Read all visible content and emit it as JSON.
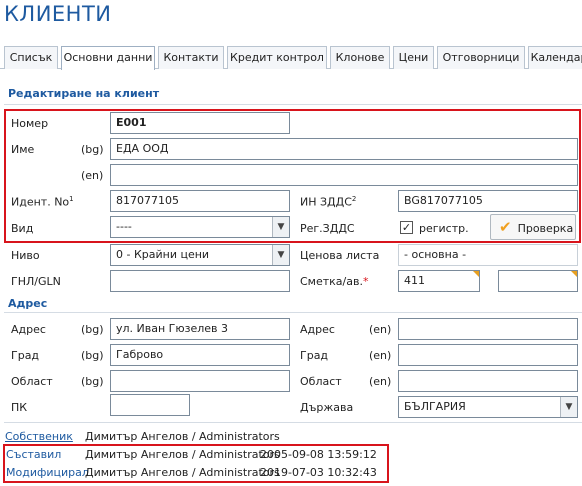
{
  "page_title": "КЛИЕНТИ",
  "tabs": [
    "Списък",
    "Основни данни",
    "Контакти",
    "Кредит контрол",
    "Клонове",
    "Цени",
    "Отговорници",
    "Календар"
  ],
  "active_tab": "Основни данни",
  "form": {
    "section_title": "Редактиране на клиент",
    "number_label": "Номер",
    "number_value": "E001",
    "name_label": "Име",
    "lang_bg": "(bg)",
    "lang_en": "(en)",
    "name_bg_value": "ЕДА ООД",
    "name_en_value": "",
    "ident_label": "Идент. No",
    "ident_sup": "1",
    "ident_value": "817077105",
    "vat_label": "ИН ЗДДС",
    "vat_sup": "2",
    "vat_value": "BG817077105",
    "type_label": "Вид",
    "type_value": "----",
    "reg_vat_label": "Рег.ЗДДС",
    "registered_checked": true,
    "registered_label": "регистр.",
    "check_button_label": "Проверка",
    "level_label": "Ниво",
    "level_value": "0 - Крайни цени",
    "price_list_label": "Ценова листа",
    "price_list_value": "- основна -",
    "gln_label": "ГНЛ/GLN",
    "gln_value": "",
    "account_label": "Сметка/ав.",
    "account_asterisk": "*",
    "account_value": "411",
    "account_extra_value": ""
  },
  "address": {
    "section_title": "Адрес",
    "address_label": "Адрес",
    "address_bg_value": "ул. Иван Гюзелев 3",
    "address_en_value": "",
    "city_label": "Град",
    "city_bg_value": "Габрово",
    "city_en_value": "",
    "region_label": "Област",
    "region_bg_value": "",
    "region_en_value": "",
    "postcode_label": "ПК",
    "postcode_value": "",
    "country_label": "Държава",
    "country_value": "БЪЛГАРИЯ",
    "lang_bg": "(bg)",
    "lang_en": "(en)"
  },
  "footer": {
    "owner_label": "Собственик",
    "owner_value": "Димитър Ангелов / Administrators",
    "created_label": "Съставил",
    "created_value": "Димитър Ангелов / Administrators",
    "created_time": "2005-09-08 13:59:12",
    "modified_label": "Модифицирал",
    "modified_value": "Димитър Ангелов / Administrators",
    "modified_time": "2019-07-03 10:32:43"
  },
  "colors": {
    "accent": "#1e5aa0",
    "highlight_red": "#d8141c",
    "check_orange": "#f0a020"
  },
  "icons": [
    "chevron-down-icon",
    "checkmark-icon",
    "corner-marker-icon"
  ]
}
